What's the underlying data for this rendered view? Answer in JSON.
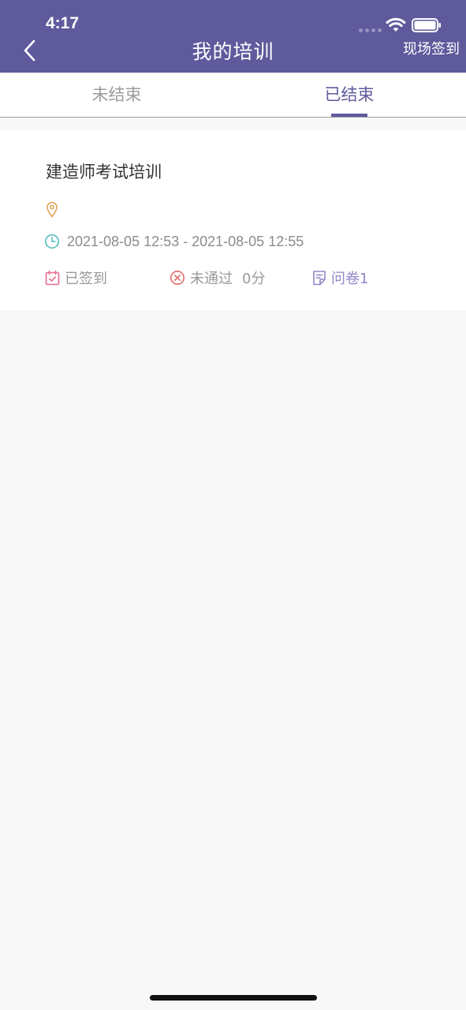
{
  "status_bar": {
    "time": "4:17"
  },
  "header": {
    "title": "我的培训",
    "checkin_label": "现场签到"
  },
  "tabs": [
    {
      "label": "未结束",
      "active": false
    },
    {
      "label": "已结束",
      "active": true
    }
  ],
  "training": {
    "title": "建造师考试培训",
    "location": "",
    "time_range": "2021-08-05 12:53 - 2021-08-05 12:55",
    "signed_status": "已签到",
    "result": "未通过",
    "score": "0分",
    "survey": "问卷1"
  },
  "colors": {
    "brand": "#5e5a9c",
    "location_icon": "#e2a55a",
    "time_icon": "#5bc3c0",
    "signed_icon": "#e86b8f",
    "fail_icon": "#e46a6a",
    "survey": "#8e88c8"
  }
}
